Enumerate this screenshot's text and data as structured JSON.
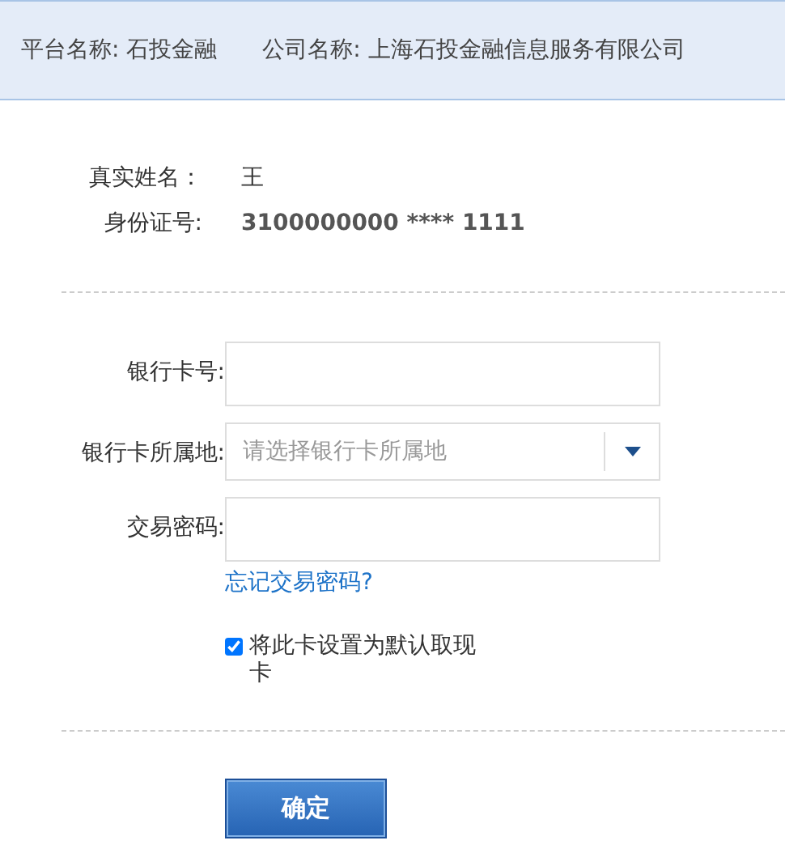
{
  "header": {
    "items": [
      "平台名称: 石投金融",
      "公司名称: 上海石投金融信息服务有限公司"
    ]
  },
  "info": [
    {
      "label": "真实姓名：",
      "value": "王",
      "bold": false
    },
    {
      "label": "身份证号:",
      "value": "3100000000 **** 1111",
      "bold": true
    }
  ],
  "form": {
    "fields": [
      {
        "kind": "text",
        "label": "银行卡号:"
      },
      {
        "kind": "select",
        "label": "银行卡所属地:",
        "placeholder": "请选择银行卡所属地"
      },
      {
        "kind": "password",
        "label": "交易密码:",
        "link": "忘记交易密码?"
      }
    ],
    "default_card": {
      "label": "将此卡设置为默认取现卡",
      "checked": true
    }
  },
  "buttons": [
    "确定"
  ]
}
